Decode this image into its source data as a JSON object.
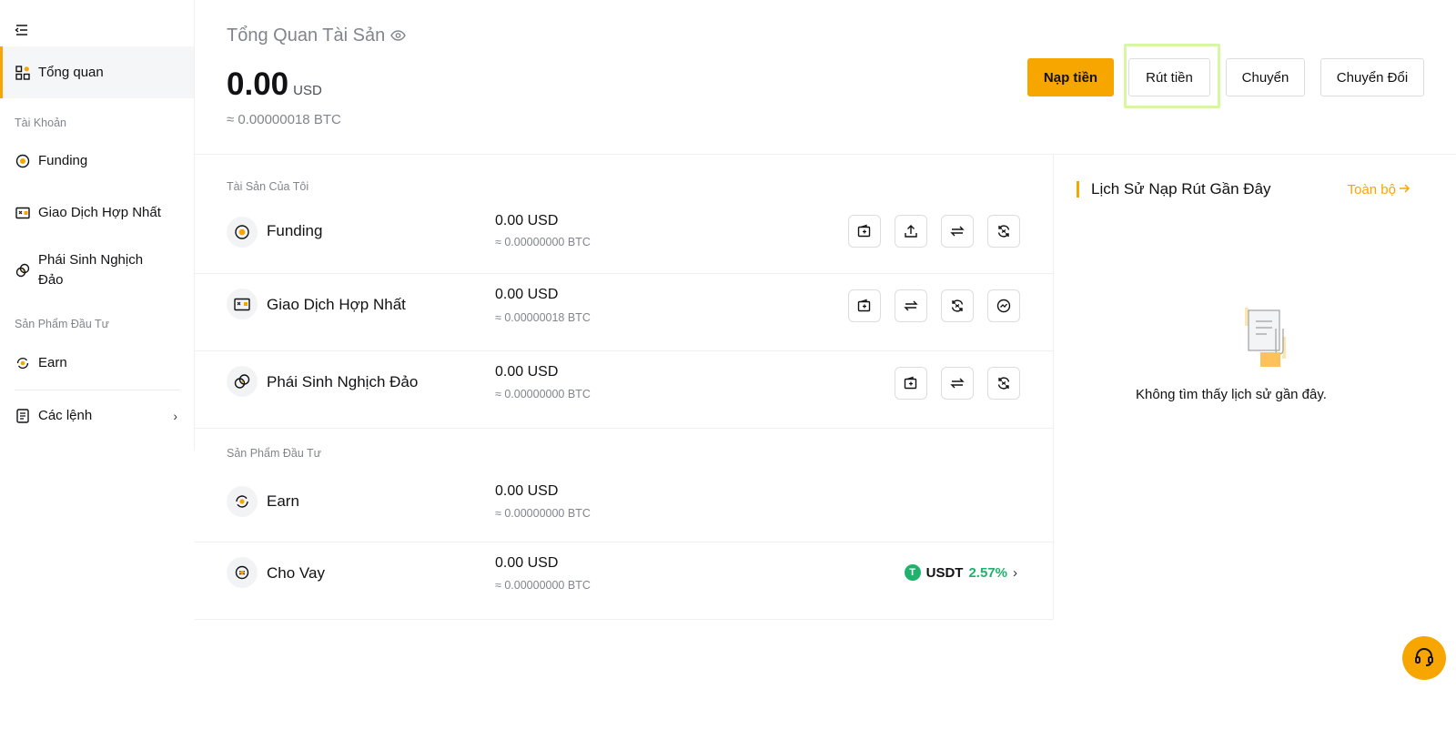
{
  "sidebar": {
    "overview": "Tổng quan",
    "account_group": "Tài Khoản",
    "funding": "Funding",
    "unified": "Giao Dịch Hợp Nhất",
    "inverse_line1": "Phái Sinh Nghịch",
    "inverse_line2": "Đảo",
    "invest_group": "Sản Phẩm Đầu Tư",
    "earn": "Earn",
    "orders": "Các lệnh"
  },
  "header": {
    "title": "Tổng Quan Tài Sản",
    "total": "0.00",
    "unit": "USD",
    "btc": "≈ 0.00000018 BTC",
    "deposit": "Nạp tiền",
    "withdraw": "Rút tiền",
    "transfer": "Chuyển",
    "convert": "Chuyển Đổi"
  },
  "assets": {
    "section_mine": "Tài Sản Của Tôi",
    "section_invest": "Sản Phẩm Đầu Tư",
    "rows": [
      {
        "name": "Funding",
        "value": "0.00 USD",
        "btc": "≈ 0.00000000 BTC"
      },
      {
        "name": "Giao Dịch Hợp Nhất",
        "value": "0.00 USD",
        "btc": "≈ 0.00000018 BTC"
      },
      {
        "name": "Phái Sinh Nghịch Đảo",
        "value": "0.00 USD",
        "btc": "≈ 0.00000000 BTC"
      },
      {
        "name": "Earn",
        "value": "0.00 USD",
        "btc": "≈ 0.00000000 BTC"
      },
      {
        "name": "Cho Vay",
        "value": "0.00 USD",
        "btc": "≈ 0.00000000 BTC"
      }
    ],
    "loan_coin": "USDT",
    "loan_apr": "2.57%"
  },
  "history": {
    "title": "Lịch Sử Nạp Rút Gần Đây",
    "all": "Toàn bộ",
    "empty": "Không tìm thấy lịch sử gần đây."
  },
  "colors": {
    "accent": "#f7a600",
    "positive": "#20b26c"
  },
  "icons": {
    "collapse": "collapse-menu-icon",
    "overview": "dashboard-grid-icon",
    "funding": "coin-icon",
    "unified": "wallet-card-icon",
    "inverse": "linked-circles-icon",
    "earn": "earn-cycle-icon",
    "orders": "document-list-icon",
    "eye": "eye-icon",
    "deposit": "deposit-icon",
    "withdraw": "upload-icon",
    "transfer": "swap-arrows-icon",
    "convert": "convert-cycle-icon",
    "chart": "trend-chart-icon",
    "support": "headset-icon"
  }
}
